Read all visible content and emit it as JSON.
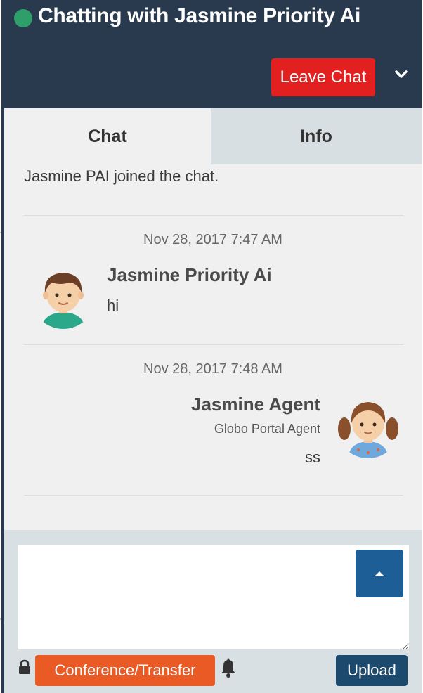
{
  "header": {
    "title": "Chatting with Jasmine Priority Ai",
    "status": "online",
    "status_color": "#2e9e6b",
    "leave_label": "Leave Chat"
  },
  "tabs": [
    {
      "label": "Chat",
      "active": true
    },
    {
      "label": "Info",
      "active": false
    }
  ],
  "chat": {
    "system_message": "Jasmine PAI joined the chat.",
    "messages": [
      {
        "timestamp": "Nov 28, 2017 7:47 AM",
        "sender": "Jasmine Priority Ai",
        "text": "hi",
        "avatar": "boy-avatar",
        "side": "left"
      },
      {
        "timestamp": "Nov 28, 2017 7:48 AM",
        "sender": "Jasmine Agent",
        "role": "Globo Portal Agent",
        "text": "ss",
        "avatar": "girl-avatar",
        "side": "right"
      }
    ]
  },
  "compose": {
    "placeholder": "",
    "conference_label": "Conference/Transfer",
    "upload_label": "Upload"
  },
  "colors": {
    "header_bg": "#2a3a4e",
    "leave_btn": "#e1201f",
    "conference_btn": "#ea5a25",
    "send_btn": "#1c5e95",
    "upload_btn": "#1c4a6f"
  }
}
